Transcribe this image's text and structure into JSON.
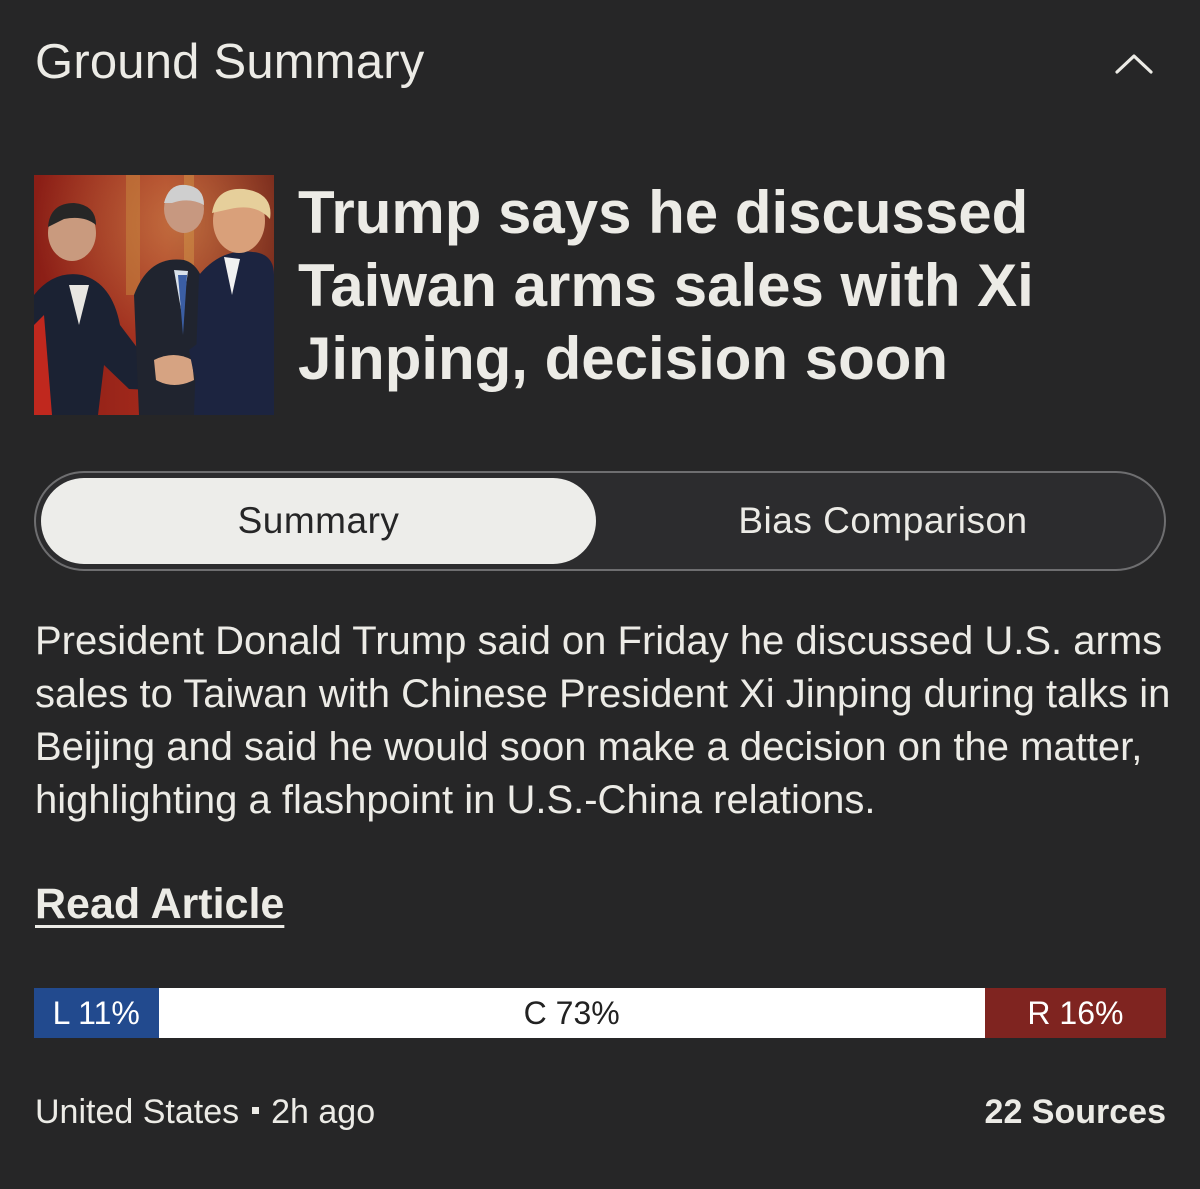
{
  "header": {
    "title": "Ground Summary"
  },
  "story": {
    "headline": "Trump says he discussed Taiwan arms sales with Xi Jinping, decision soon",
    "summary": "President Donald Trump said on Friday he discussed U.S. arms sales to Taiwan with Chinese President Xi Jinping during talks in Beijing and said he would soon make a decision on the matter, highlighting a flashpoint in U.S.-China relations.",
    "read_article_label": "Read Article"
  },
  "tabs": {
    "items": [
      {
        "label": "Summary",
        "active": true
      },
      {
        "label": "Bias Comparison",
        "active": false
      }
    ]
  },
  "bias": {
    "left": {
      "label": "L 11%",
      "percent": 11,
      "color": "#224a8e"
    },
    "center": {
      "label": "C 73%",
      "percent": 73,
      "color": "#ffffff"
    },
    "right": {
      "label": "R 16%",
      "percent": 16,
      "color": "#7f2420"
    }
  },
  "footer": {
    "location": "United States",
    "time": "2h ago",
    "sources": "22 Sources"
  },
  "icons": {
    "collapse": "chevron-up-icon"
  }
}
